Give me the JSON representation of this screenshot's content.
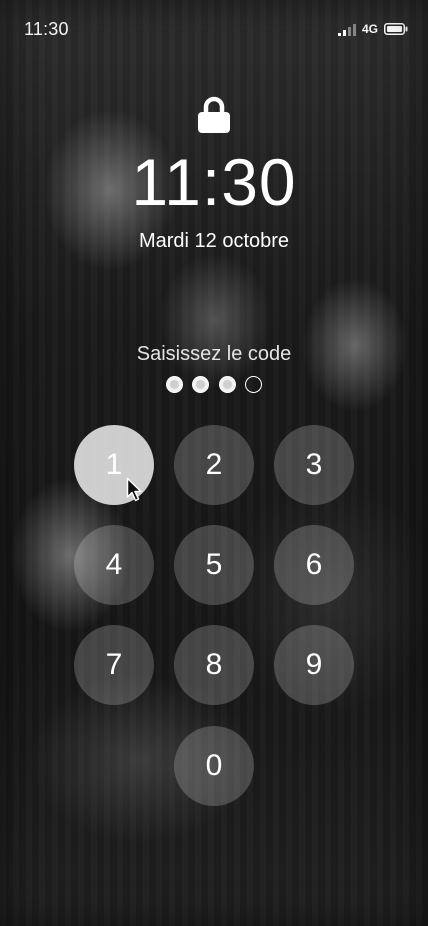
{
  "status_bar": {
    "time": "11:30",
    "network": "4G",
    "signal_icon": "signal-bars-icon",
    "battery_icon": "battery-icon"
  },
  "lock_screen": {
    "lock_icon": "lock-icon",
    "clock": "11:30",
    "date": "Mardi 12 octobre",
    "prompt": "Saisissez le code",
    "pin_entered": 3,
    "pin_length": 4
  },
  "keypad": {
    "keys": [
      "1",
      "2",
      "3",
      "4",
      "5",
      "6",
      "7",
      "8",
      "9",
      "0"
    ],
    "pressed_key": "1"
  },
  "cursor": {
    "icon": "mouse-pointer-icon"
  }
}
